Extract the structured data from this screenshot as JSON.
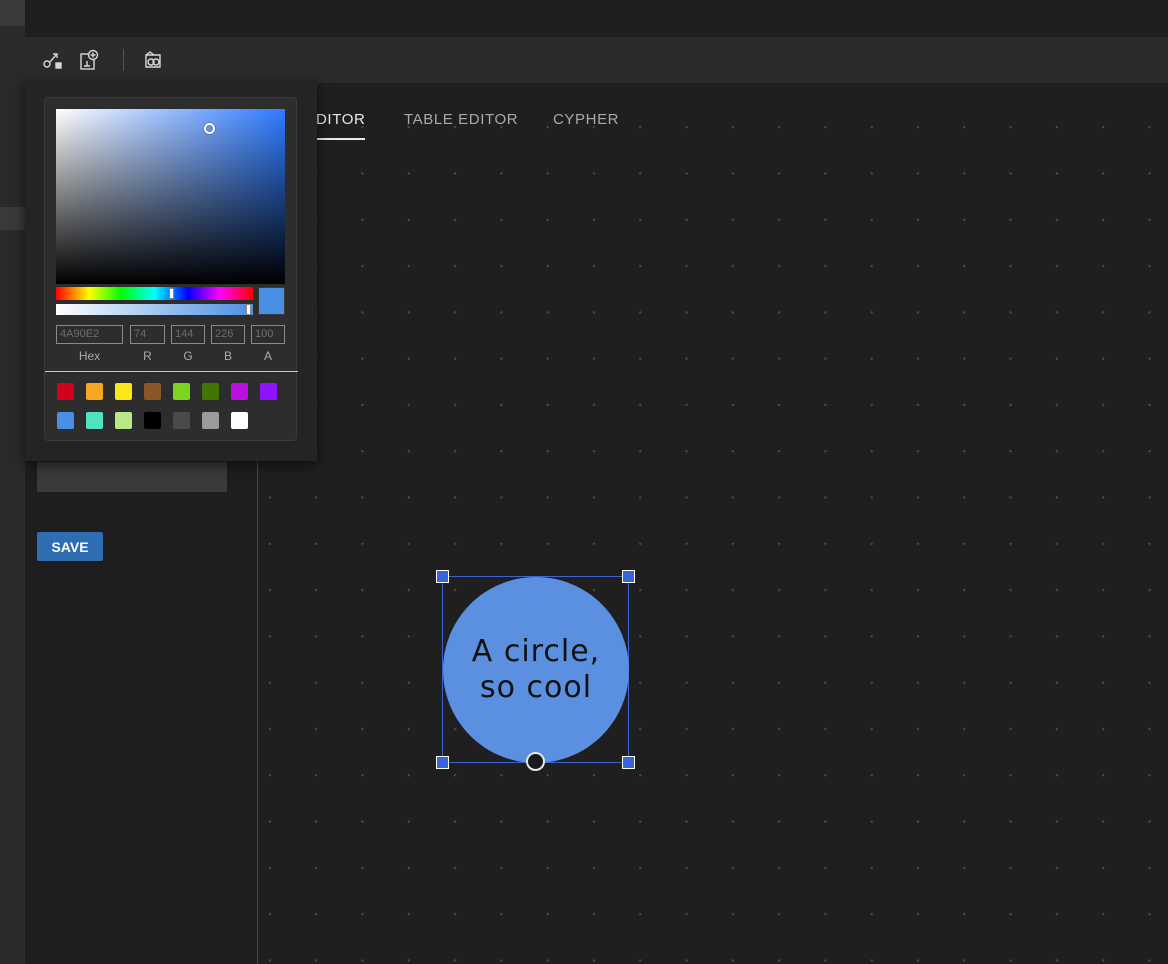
{
  "toolbar": {
    "icons": [
      "connect-nodes-icon",
      "add-node-icon",
      "theme-icon"
    ]
  },
  "tabs": [
    {
      "label": "DITOR",
      "active": true
    },
    {
      "label": "TABLE EDITOR",
      "active": false
    },
    {
      "label": "CYPHER",
      "active": false
    }
  ],
  "sidebar": {
    "save_label": "SAVE"
  },
  "color_picker": {
    "hex": "4A90E2",
    "r": "74",
    "g": "144",
    "b": "226",
    "a": "100",
    "labels": {
      "hex": "Hex",
      "r": "R",
      "g": "G",
      "b": "B",
      "a": "A"
    },
    "selected_color": "#4a90e2",
    "presets": [
      "#d0021b",
      "#f5a623",
      "#f8e71c",
      "#8b572a",
      "#7ed321",
      "#417505",
      "#bd10e0",
      "#9013fe",
      "#4a90e2",
      "#50e3c2",
      "#b8e986",
      "#000000",
      "#4a4a4a",
      "#9b9b9b",
      "#ffffff"
    ]
  },
  "canvas": {
    "shape_text": "A circle, so cool",
    "shape_fill": "#5b8fe0"
  }
}
